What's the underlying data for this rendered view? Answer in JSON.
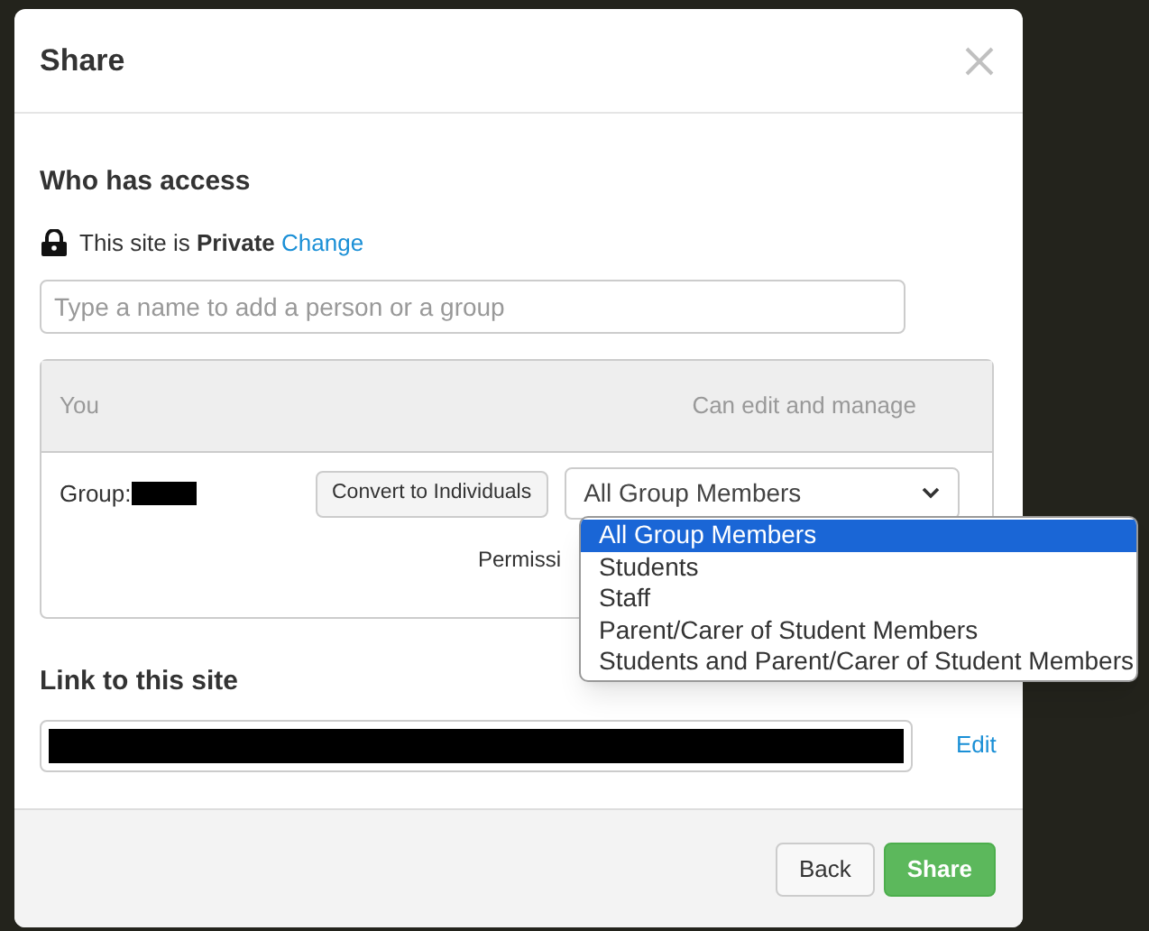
{
  "dialog": {
    "title": "Share"
  },
  "access": {
    "heading": "Who has access",
    "privacy_text": "This site is **Private**",
    "change_link": "Change",
    "search": {
      "placeholder": "Type a name to add a person or a group"
    }
  },
  "members_table": {
    "columns": [
      "You",
      "Can edit and manage"
    ],
    "rows": [
      {
        "label": "Group:",
        "redacted": true,
        "convert_button": "Convert to Individuals",
        "select_value": "All Group Members",
        "note": "Permissi"
      }
    ]
  },
  "dropdown": {
    "options": [
      {
        "label": "All Group Members",
        "selected": true
      },
      {
        "label": "Students",
        "selected": false
      },
      {
        "label": "Staff",
        "selected": false
      },
      {
        "label": "Parent/Carer of Student Members",
        "selected": false
      },
      {
        "label": "Students and Parent/Carer of Student Members",
        "selected": false
      }
    ]
  },
  "link": {
    "heading": "Link to this site",
    "redacted": true,
    "edit_link": "Edit"
  },
  "footer": {
    "buttons": [
      {
        "label": "Back",
        "kind": "secondary"
      },
      {
        "label": "Share",
        "kind": "primary"
      }
    ]
  }
}
